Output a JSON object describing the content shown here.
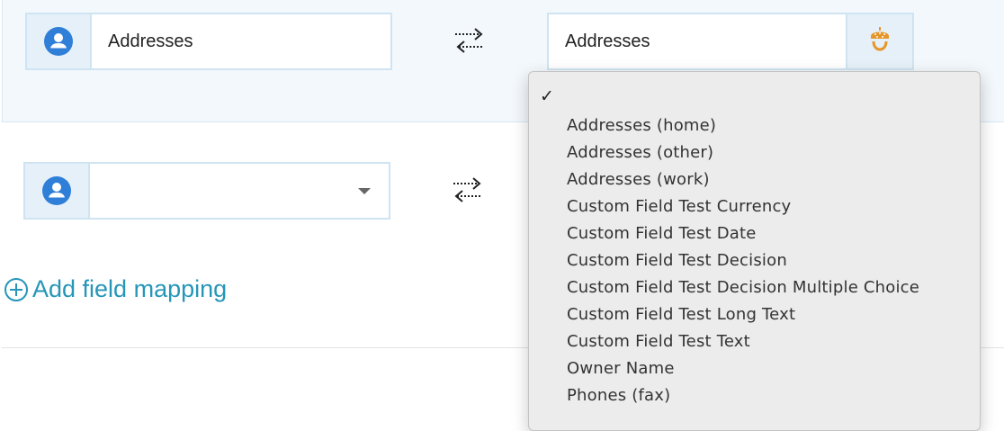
{
  "mapping_rows": [
    {
      "source_field": "Addresses",
      "target_field": "Addresses"
    },
    {
      "source_field": ""
    }
  ],
  "add_mapping_label": "Add field mapping",
  "dropdown": {
    "selected_mark": "✓",
    "options": [
      "Addresses (home)",
      "Addresses (other)",
      "Addresses (work)",
      "Custom Field Test Currency",
      "Custom Field Test Date",
      "Custom Field Test Decision",
      "Custom Field Test Decision Multiple Choice",
      "Custom Field Test Long Text",
      "Custom Field Test Text",
      "Owner Name",
      "Phones (fax)"
    ]
  },
  "colors": {
    "accent_blue": "#2f7fd8",
    "link_teal": "#2596b8",
    "acorn_orange": "#e6962a",
    "panel_bg": "#f3f8fc",
    "field_border": "#cfe4f2"
  },
  "icons": {
    "source": "person-circle-icon",
    "swap": "swap-arrows-icon",
    "target": "acorn-icon",
    "add": "plus-circle-icon",
    "select": "caret-down-icon"
  }
}
